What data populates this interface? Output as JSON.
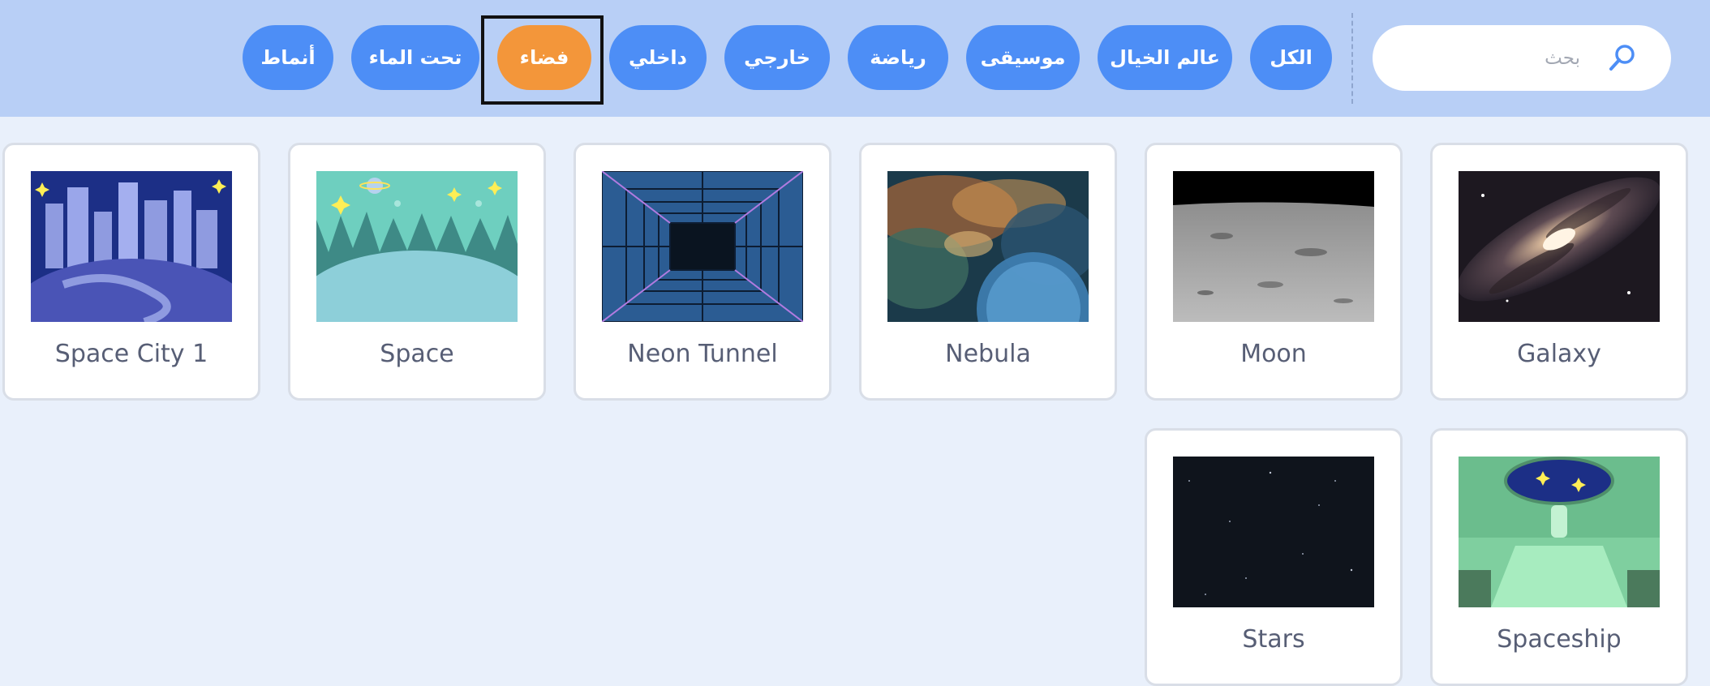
{
  "search": {
    "placeholder": "بحث",
    "icon": "search-icon"
  },
  "categories": [
    {
      "label": "الكل",
      "active": false
    },
    {
      "label": "عالم الخيال",
      "active": false
    },
    {
      "label": "موسيقى",
      "active": false
    },
    {
      "label": "رياضة",
      "active": false
    },
    {
      "label": "خارجي",
      "active": false
    },
    {
      "label": "داخلي",
      "active": false
    },
    {
      "label": "فضاء",
      "active": true
    },
    {
      "label": "تحت الماء",
      "active": false
    },
    {
      "label": "أنماط",
      "active": false
    }
  ],
  "backdrops": [
    {
      "name": "Galaxy"
    },
    {
      "name": "Moon"
    },
    {
      "name": "Nebula"
    },
    {
      "name": "Neon Tunnel"
    },
    {
      "name": "Space"
    },
    {
      "name": "Space City 1"
    },
    {
      "name": "Spaceship"
    },
    {
      "name": "Stars"
    }
  ],
  "colors": {
    "category_pill": "#4d8ef6",
    "category_active": "#f3963a",
    "topbar": "#b8cff6",
    "page_background": "#e9f0fb",
    "card_title": "#575e75"
  }
}
